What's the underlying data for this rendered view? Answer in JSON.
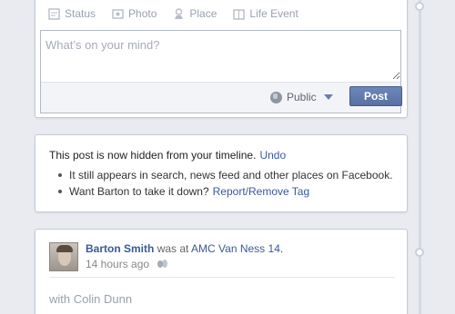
{
  "composer": {
    "tabs": [
      {
        "label": "Status",
        "icon": "status-icon"
      },
      {
        "label": "Photo",
        "icon": "photo-icon"
      },
      {
        "label": "Place",
        "icon": "place-icon"
      },
      {
        "label": "Life Event",
        "icon": "life-event-icon"
      }
    ],
    "placeholder": "What’s on your mind?",
    "privacy_label": "Public",
    "post_label": "Post"
  },
  "notice": {
    "message": "This post is now hidden from your timeline.",
    "undo_label": "Undo",
    "bullet1": "It still appears in search, news feed and other places on Facebook.",
    "bullet2_text": "Want Barton to take it down?",
    "bullet2_link": "Report/Remove Tag"
  },
  "story": {
    "author": "Barton Smith",
    "verb": "was at",
    "place": "AMC Van Ness 14.",
    "time": "14 hours ago",
    "with_text": "with Colin Dunn"
  },
  "colors": {
    "link": "#3b5998",
    "post_button": "#5a70a3",
    "background": "#e9ebf0"
  }
}
